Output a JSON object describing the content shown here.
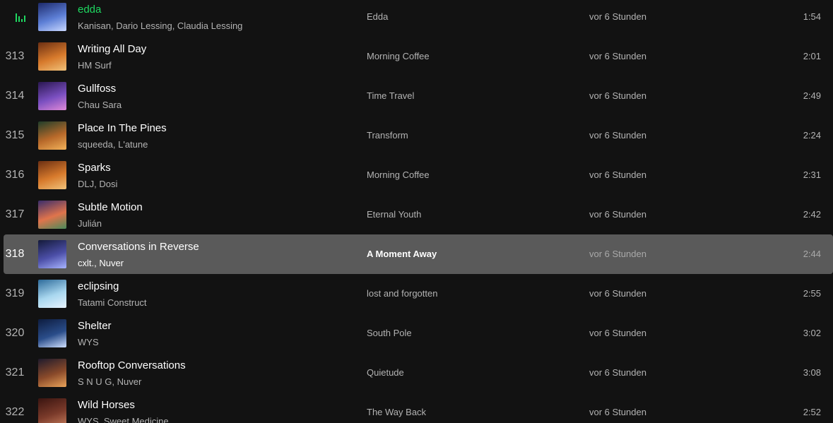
{
  "colors": {
    "background": "#121212",
    "accent": "#1ed760",
    "selected_row": "#5a5a5a",
    "text_primary": "#ffffff",
    "text_secondary": "#b3b3b3"
  },
  "tracks": [
    {
      "index": "",
      "now_playing": true,
      "title": "edda",
      "artists": "Kanisan, Dario Lessing, Claudia Lessing",
      "album": "Edda",
      "added": "vor 6 Stunden",
      "duration": "1:54",
      "cover": [
        "#1d2a6b",
        "#5d7fd6",
        "#c9d8ff"
      ]
    },
    {
      "index": "313",
      "title": "Writing All Day",
      "artists": "HM Surf",
      "album": "Morning Coffee",
      "added": "vor 6 Stunden",
      "duration": "2:01",
      "cover": [
        "#6b2f12",
        "#d77a2c",
        "#f0c27a"
      ]
    },
    {
      "index": "314",
      "title": "Gullfoss",
      "artists": "Chau Sara",
      "album": "Time Travel",
      "added": "vor 6 Stunden",
      "duration": "2:49",
      "cover": [
        "#2a1750",
        "#7a4fc0",
        "#e08ad8"
      ]
    },
    {
      "index": "315",
      "title": "Place In The Pines",
      "artists": "squeeda, L'atune",
      "album": "Transform",
      "added": "vor 6 Stunden",
      "duration": "2:24",
      "cover": [
        "#1f3d2a",
        "#b8692a",
        "#f2b25a"
      ]
    },
    {
      "index": "316",
      "title": "Sparks",
      "artists": "DLJ, Dosi",
      "album": "Morning Coffee",
      "added": "vor 6 Stunden",
      "duration": "2:31",
      "cover": [
        "#6b2f12",
        "#d77a2c",
        "#f0c27a"
      ]
    },
    {
      "index": "317",
      "title": "Subtle Motion",
      "artists": "Julián",
      "album": "Eternal Youth",
      "added": "vor 6 Stunden",
      "duration": "2:42",
      "cover": [
        "#3a2d6b",
        "#e0744c",
        "#4a8a5a"
      ]
    },
    {
      "index": "318",
      "selected": true,
      "title": "Conversations in Reverse",
      "artists": "cxlt., Nuver",
      "album": "A Moment Away",
      "added": "vor 6 Stunden",
      "duration": "2:44",
      "cover": [
        "#141a3a",
        "#4c4fa8",
        "#a8b4ff"
      ]
    },
    {
      "index": "319",
      "title": "eclipsing",
      "artists": "Tatami Construct",
      "album": "lost and forgotten",
      "added": "vor 6 Stunden",
      "duration": "2:55",
      "cover": [
        "#2c6a9a",
        "#a9d7ef",
        "#e8f4ff"
      ]
    },
    {
      "index": "320",
      "title": "Shelter",
      "artists": "WYS",
      "album": "South Pole",
      "added": "vor 6 Stunden",
      "duration": "3:02",
      "cover": [
        "#0d1c3f",
        "#2a4d8a",
        "#cfe0ff"
      ]
    },
    {
      "index": "321",
      "title": "Rooftop Conversations",
      "artists": "S N U G, Nuver",
      "album": "Quietude",
      "added": "vor 6 Stunden",
      "duration": "3:08",
      "cover": [
        "#1e1a2c",
        "#8a4a2a",
        "#e9a35a"
      ]
    },
    {
      "index": "322",
      "title": "Wild Horses",
      "artists": "WYS, Sweet Medicine",
      "album": "The Way Back",
      "added": "vor 6 Stunden",
      "duration": "2:52",
      "cover": [
        "#3a1410",
        "#7a3a2a",
        "#c27a5a"
      ]
    }
  ]
}
